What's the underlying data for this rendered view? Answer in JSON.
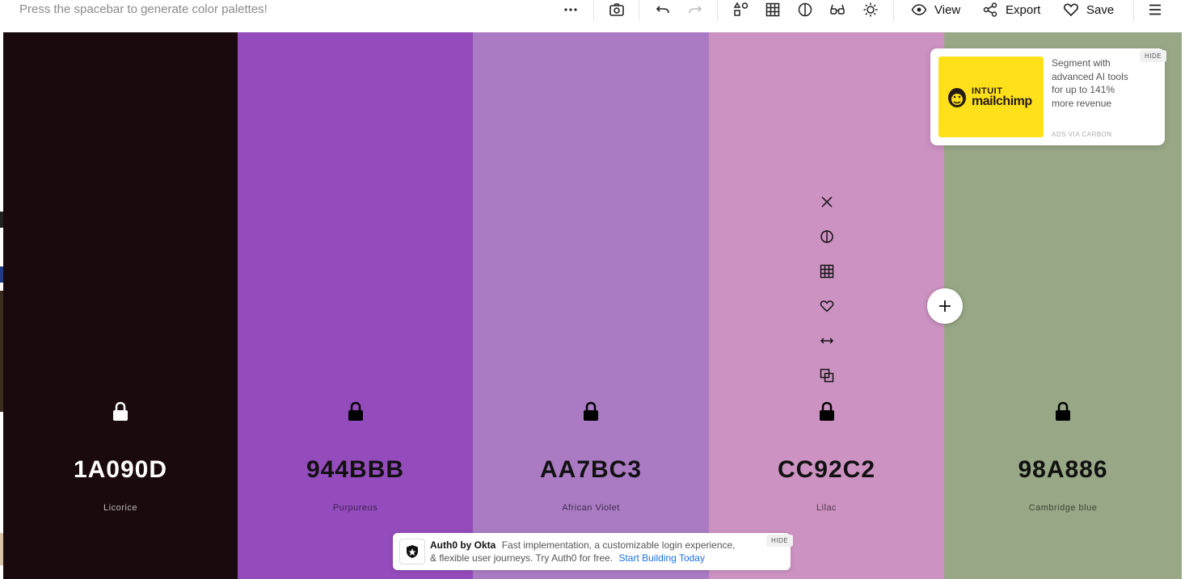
{
  "toolbar": {
    "hint": "Press the spacebar to generate color palettes!",
    "view_label": "View",
    "export_label": "Export",
    "save_label": "Save"
  },
  "swatches": [
    {
      "hex": "1A090D",
      "name": "Licorice",
      "color": "#1A090D",
      "text_color": "#ffffff",
      "name_color": "#bbbbbb"
    },
    {
      "hex": "944BBB",
      "name": "Purpureus",
      "color": "#944BBB",
      "text_color": "#111111",
      "name_color": "#3a2450"
    },
    {
      "hex": "AA7BC3",
      "name": "African Violet",
      "color": "#AA7BC3",
      "text_color": "#111111",
      "name_color": "#3e2c4a"
    },
    {
      "hex": "CC92C2",
      "name": "Lilac",
      "color": "#CC92C2",
      "text_color": "#111111",
      "name_color": "#50384c"
    },
    {
      "hex": "98A886",
      "name": "Cambridge blue",
      "color": "#98A886",
      "text_color": "#111111",
      "name_color": "#3c4434"
    }
  ],
  "swatch_tools": [
    "close-icon",
    "contrast-icon",
    "shades-grid-icon",
    "heart-icon",
    "drag-arrows-icon",
    "copy-icon"
  ],
  "ad": {
    "brand_top": "INTUIT",
    "brand_main": "mailchimp",
    "text": "Segment with advanced AI tools for up to 141% more revenue",
    "via": "ADS VIA CARBON",
    "hide": "HIDE"
  },
  "bottom_ad": {
    "brand": "Auth0 by Okta",
    "text1": "Fast implementation, a customizable login experience,",
    "text2": "& flexible user journeys. Try Auth0 for free.",
    "cta": "Start Building Today",
    "hide": "HIDE"
  }
}
